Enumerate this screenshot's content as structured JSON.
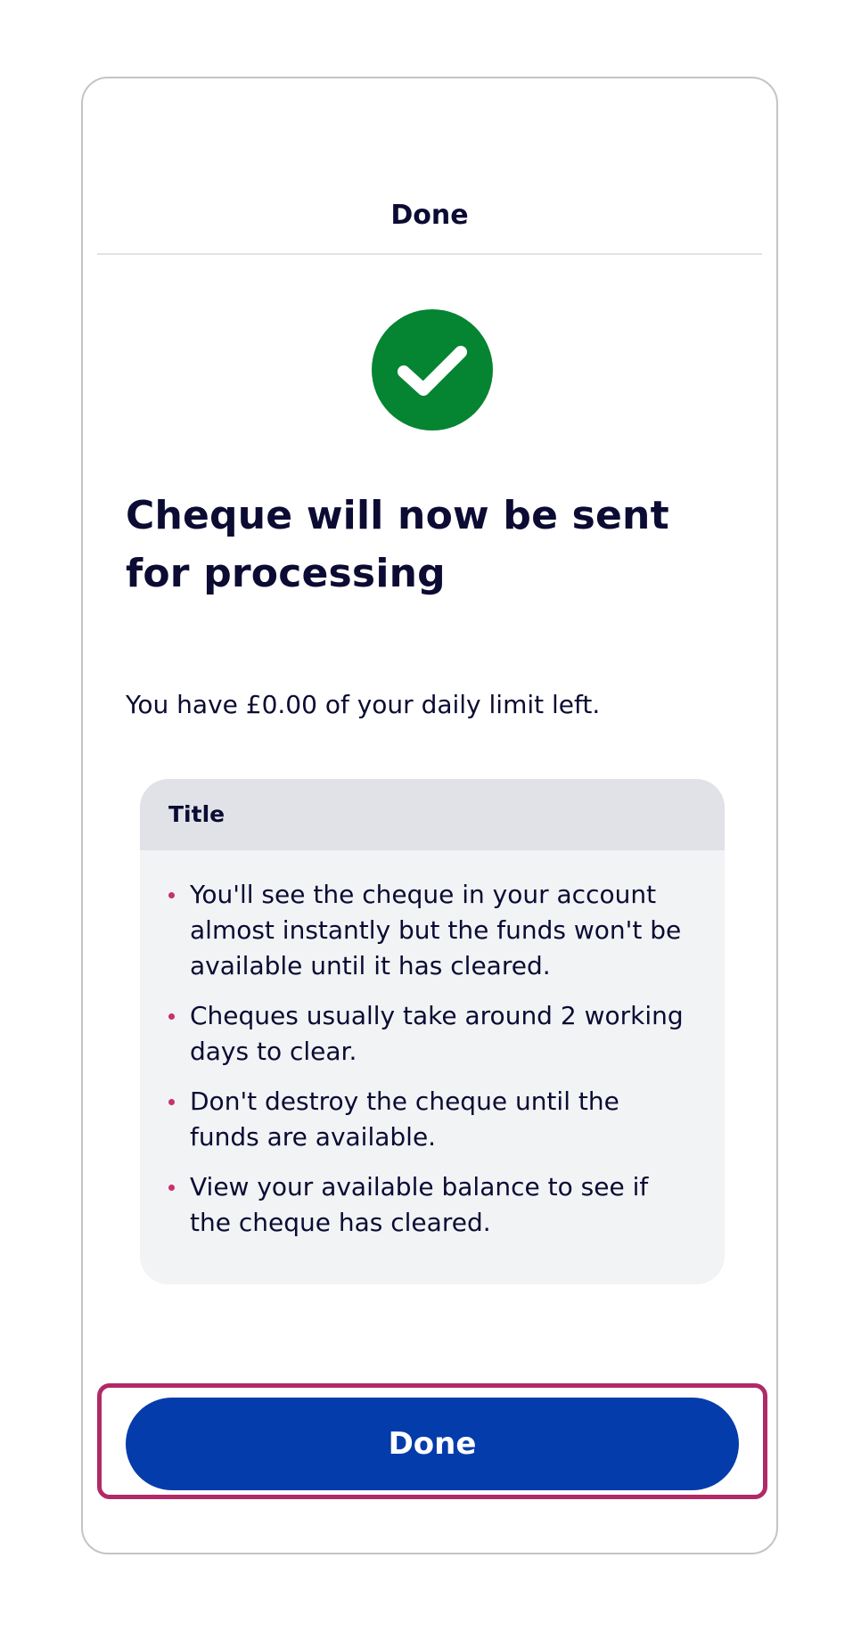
{
  "header": {
    "title": "Done"
  },
  "status": {
    "icon": "checkmark-circle-icon",
    "color": "#058432"
  },
  "main": {
    "heading": "Cheque will now be sent for processing",
    "limit_text": "You have £0.00 of your daily limit left."
  },
  "info_box": {
    "title": "Title",
    "bullet_color": "#c8306e",
    "items": [
      "You'll see the cheque in your account almost instantly but the funds won't be available until it has cleared.",
      "Cheques usually take around 2 working days to clear.",
      "Don't destroy the cheque until the funds are available.",
      "View your available balance to see if the cheque has cleared."
    ]
  },
  "footer": {
    "done_label": "Done",
    "button_color": "#053cab",
    "focus_color": "#b12a68"
  }
}
